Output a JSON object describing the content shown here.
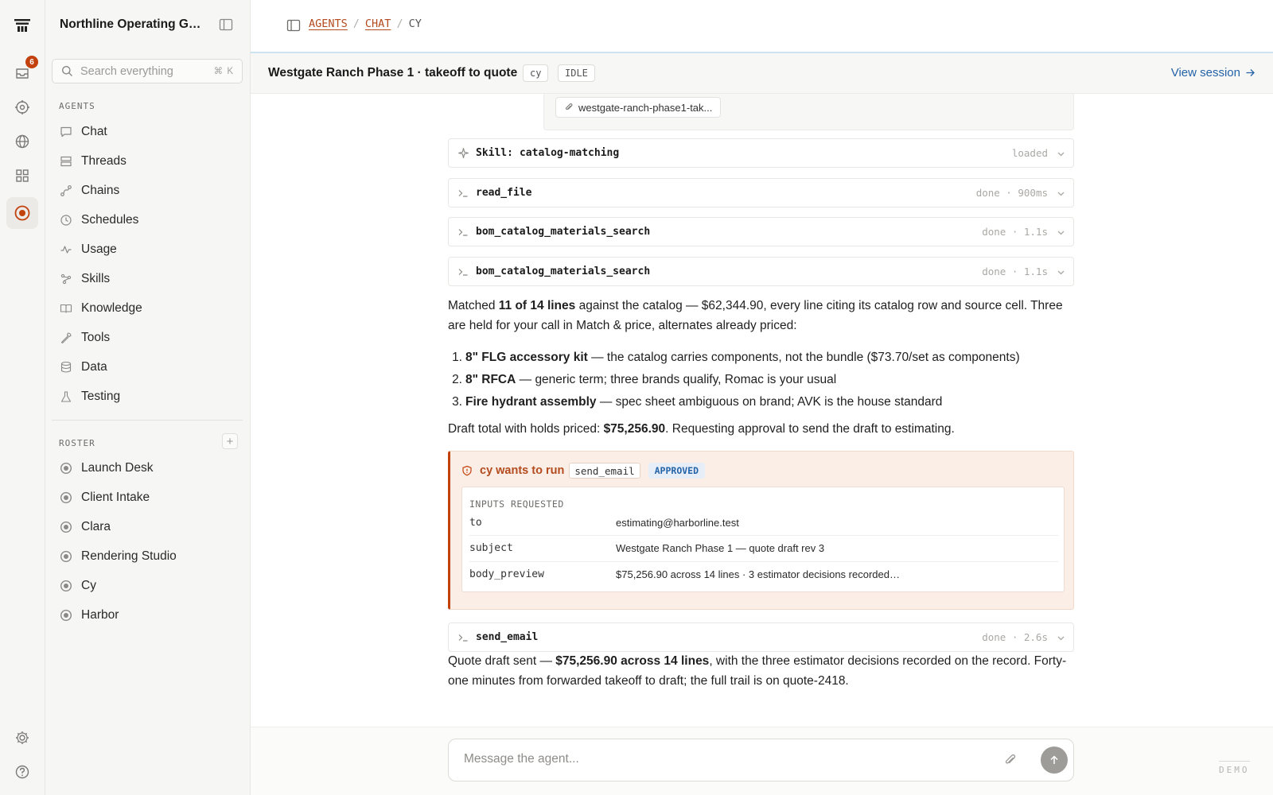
{
  "app": {
    "org_name": "Northline Operating Gro...",
    "inbox_badge": "6",
    "accent": "#c2410c",
    "link_color": "#2563a8"
  },
  "rail": {
    "items": [
      {
        "icon": "inbox-icon"
      },
      {
        "icon": "target-icon"
      },
      {
        "icon": "globe-icon"
      },
      {
        "icon": "grid-icon"
      },
      {
        "icon": "agent-icon",
        "active": true
      }
    ],
    "bottom": [
      {
        "icon": "gear-icon"
      },
      {
        "icon": "help-icon"
      }
    ]
  },
  "search": {
    "placeholder": "Search everything",
    "shortcut": "⌘ K"
  },
  "sidebar": {
    "agents_label": "AGENTS",
    "items": [
      {
        "label": "Chat",
        "icon": "chat-icon"
      },
      {
        "label": "Threads",
        "icon": "threads-icon"
      },
      {
        "label": "Chains",
        "icon": "chains-icon"
      },
      {
        "label": "Schedules",
        "icon": "clock-icon"
      },
      {
        "label": "Usage",
        "icon": "activity-icon"
      },
      {
        "label": "Skills",
        "icon": "skills-icon"
      },
      {
        "label": "Knowledge",
        "icon": "book-icon"
      },
      {
        "label": "Tools",
        "icon": "wrench-icon"
      },
      {
        "label": "Data",
        "icon": "database-icon"
      },
      {
        "label": "Testing",
        "icon": "flask-icon"
      }
    ],
    "roster_label": "ROSTER",
    "roster_add": "+",
    "roster": [
      {
        "label": "Launch Desk"
      },
      {
        "label": "Client Intake"
      },
      {
        "label": "Clara"
      },
      {
        "label": "Rendering Studio"
      },
      {
        "label": "Cy"
      },
      {
        "label": "Harbor"
      }
    ]
  },
  "breadcrumb": {
    "items": [
      "AGENTS",
      "CHAT"
    ],
    "current": "CY",
    "separator": "/"
  },
  "session": {
    "title": "Westgate Ranch Phase 1 · takeoff to quote",
    "agent_chip": "cy",
    "status_chip": "IDLE",
    "view_label": "View session"
  },
  "chat": {
    "attachment": "westgate-ranch-phase1-tak...",
    "skill": {
      "prefix": "Skill:",
      "name": "catalog-matching",
      "status": "loaded"
    },
    "tool_calls": [
      {
        "name": "read_file",
        "status": "done · 900ms"
      },
      {
        "name": "bom_catalog_materials_search",
        "status": "done · 1.1s"
      },
      {
        "name": "bom_catalog_materials_search",
        "status": "done · 1.1s"
      }
    ],
    "message1": {
      "pre": "Matched ",
      "bold": "11 of 14 lines",
      "post": " against the catalog — $62,344.90, every line citing its catalog row and source cell. Three are held for your call in Match & price, alternates already priced:"
    },
    "holds": [
      {
        "num": "1.",
        "bold": "8\" FLG accessory kit",
        "text": " — the catalog carries components, not the bundle ($73.70/set as components)"
      },
      {
        "num": "2.",
        "bold": "8\" RFCA",
        "text": " — generic term; three brands qualify, Romac is your usual"
      },
      {
        "num": "3.",
        "bold": "Fire hydrant assembly",
        "text": " — spec sheet ambiguous on brand; AVK is the house standard"
      }
    ],
    "message2": {
      "pre": "Draft total with holds priced: ",
      "bold": "$75,256.90",
      "post": ". Requesting approval to send the draft to estimating."
    },
    "approval": {
      "text": "cy wants to run",
      "tool": "send_email",
      "status": "APPROVED",
      "inputs_label": "INPUTS REQUESTED",
      "inputs": [
        {
          "key": "to",
          "value": "estimating@harborline.test"
        },
        {
          "key": "subject",
          "value": "Westgate Ranch Phase 1 — quote draft rev 3"
        },
        {
          "key": "body_preview",
          "value": "$75,256.90 across 14 lines · 3 estimator decisions recorded…"
        }
      ]
    },
    "send_call": {
      "name": "send_email",
      "status": "done · 2.6s"
    },
    "message3": {
      "pre": "Quote draft sent — ",
      "bold": "$75,256.90 across 14 lines",
      "post": ", with the three estimator decisions recorded on the record. Forty-one minutes from forwarded takeoff to draft; the full trail is on quote-2418."
    }
  },
  "composer": {
    "placeholder": "Message the agent...",
    "demo": "DEMO"
  }
}
